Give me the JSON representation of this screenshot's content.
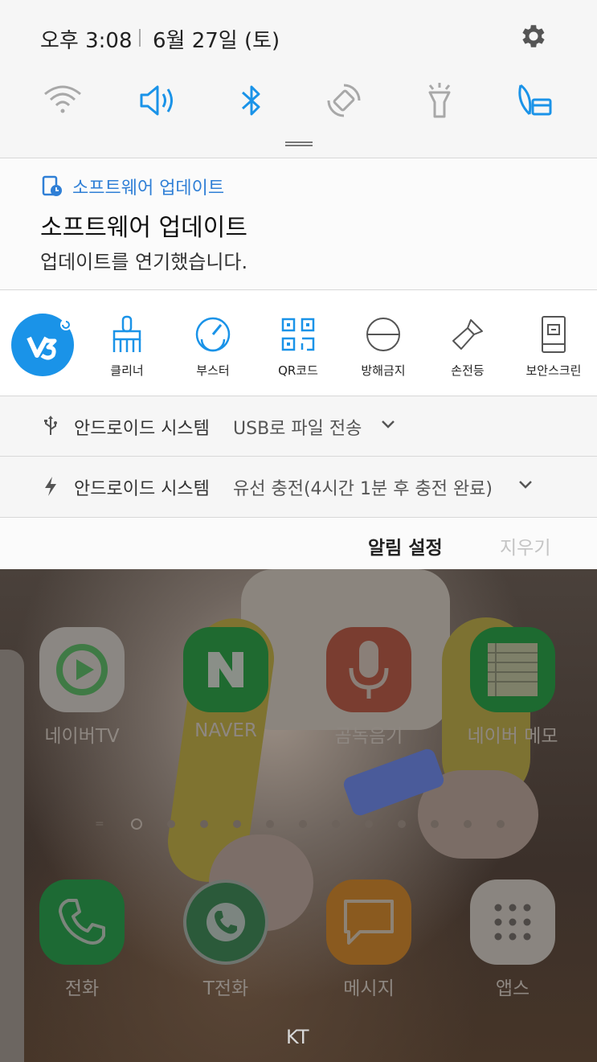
{
  "status": {
    "time": "오후 3:08",
    "date": "6월 27일 (토)"
  },
  "quick_settings": [
    {
      "icon": "wifi-icon",
      "active": false
    },
    {
      "icon": "sound-icon",
      "active": true
    },
    {
      "icon": "bluetooth-icon",
      "active": true
    },
    {
      "icon": "auto-rotate-icon",
      "active": false
    },
    {
      "icon": "flashlight-icon",
      "active": false
    },
    {
      "icon": "power-saving-icon",
      "active": true
    }
  ],
  "notification": {
    "app": "소프트웨어 업데이트",
    "title": "소프트웨어 업데이트",
    "body": "업데이트를 연기했습니다."
  },
  "tools": [
    {
      "icon": "v3-logo-icon",
      "label": ""
    },
    {
      "icon": "broom-icon",
      "label": "클리너"
    },
    {
      "icon": "booster-icon",
      "label": "부스터"
    },
    {
      "icon": "qr-code-icon",
      "label": "QR코드"
    },
    {
      "icon": "do-not-disturb-icon",
      "label": "방해금지"
    },
    {
      "icon": "flashlight-icon",
      "label": "손전등"
    },
    {
      "icon": "secure-screen-icon",
      "label": "보안스크린"
    }
  ],
  "system_notifications": [
    {
      "icon": "usb-icon",
      "app": "안드로이드 시스템",
      "message": "USB로 파일 전송"
    },
    {
      "icon": "charging-icon",
      "app": "안드로이드 시스템",
      "message": "유선 충전(4시간 1분 후 충전 완료)"
    }
  ],
  "actions": {
    "settings": "알림 설정",
    "clear": "지우기"
  },
  "home": {
    "apps": [
      {
        "name": "네이버TV",
        "icon": "naver-tv-icon"
      },
      {
        "name": "NAVER",
        "icon": "naver-icon"
      },
      {
        "name": "곰녹음기",
        "icon": "microphone-icon"
      },
      {
        "name": "네이버 메모",
        "icon": "memo-icon"
      }
    ],
    "dock": [
      {
        "name": "전화",
        "icon": "phone-icon"
      },
      {
        "name": "T전화",
        "icon": "t-phone-icon"
      },
      {
        "name": "메시지",
        "icon": "message-icon"
      },
      {
        "name": "앱스",
        "icon": "apps-grid-icon"
      }
    ],
    "carrier": "KT"
  },
  "colors": {
    "accent": "#1a93e8",
    "shade_bg": "#f6f6f6",
    "inactive_icon": "#a8a8a8"
  }
}
